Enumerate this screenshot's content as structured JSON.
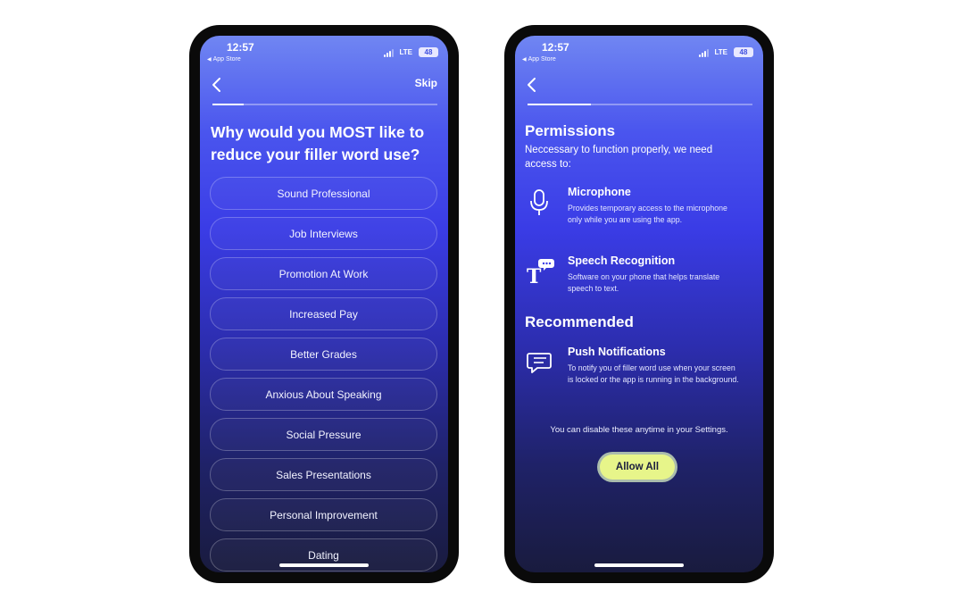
{
  "left_screen": {
    "status": {
      "time": "12:57",
      "back_app": "App Store",
      "network": "LTE",
      "battery": "48"
    },
    "nav": {
      "skip_label": "Skip"
    },
    "progress": 0.14,
    "question": "Why would you MOST like to reduce your filler word use?",
    "options": [
      "Sound Professional",
      "Job Interviews",
      "Promotion At Work",
      "Increased Pay",
      "Better Grades",
      "Anxious About Speaking",
      "Social Pressure",
      "Sales Presentations",
      "Personal Improvement",
      "Dating"
    ]
  },
  "right_screen": {
    "status": {
      "time": "12:57",
      "back_app": "App Store",
      "network": "LTE",
      "battery": "48"
    },
    "progress": 0.28,
    "permissions_title": "Permissions",
    "permissions_subtitle": "Neccessary to function properly, we need access to:",
    "permissions": [
      {
        "icon": "microphone-icon",
        "title": "Microphone",
        "description": "Provides temporary access to the microphone only while you are using the app."
      },
      {
        "icon": "speech-recognition-icon",
        "title": "Speech Recognition",
        "description": "Software on your phone that helps translate speech to text."
      }
    ],
    "recommended_title": "Recommended",
    "recommended": [
      {
        "icon": "chat-bubble-icon",
        "title": "Push Notifications",
        "description": "To notify you of filler word use when your screen is locked or the app is running in the background."
      }
    ],
    "disable_note": "You can disable these anytime in your Settings.",
    "allow_all_label": "Allow All",
    "allow_button_color": "#e7f58a"
  }
}
